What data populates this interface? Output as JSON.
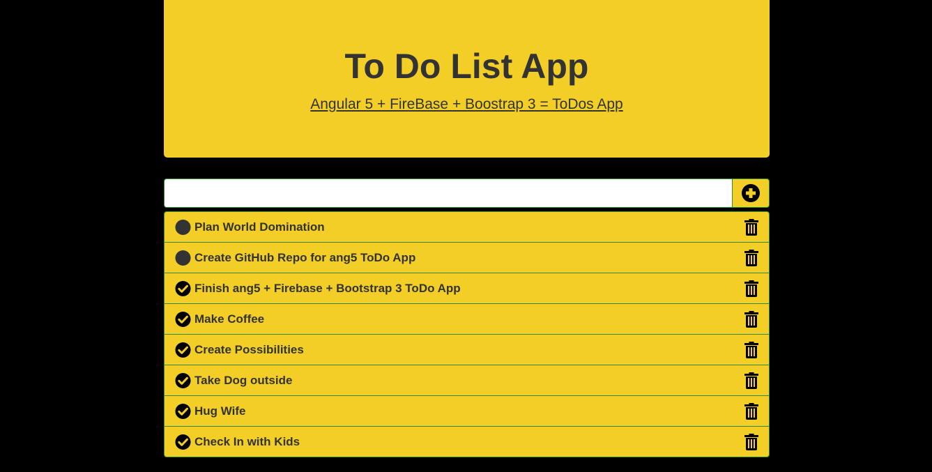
{
  "header": {
    "title": "To Do List App",
    "subtitle": "Angular 5 + FireBase + Boostrap 3 = ToDos App"
  },
  "add_form": {
    "input_value": "",
    "input_placeholder": "",
    "button_icon": "plus-circle-icon"
  },
  "todos": [
    {
      "text": "Plan World Domination",
      "done": false
    },
    {
      "text": "Create GitHub Repo for ang5 ToDo App",
      "done": false
    },
    {
      "text": "Finish ang5 + Firebase + Bootstrap 3 ToDo App",
      "done": true
    },
    {
      "text": "Make Coffee",
      "done": true
    },
    {
      "text": "Create Possibilities",
      "done": true
    },
    {
      "text": "Take Dog outside",
      "done": true
    },
    {
      "text": "Hug Wife",
      "done": true
    },
    {
      "text": "Check In with Kids",
      "done": true
    }
  ],
  "icons": {
    "pending": "circle-icon",
    "done": "check-circle-icon",
    "delete": "trash-icon"
  },
  "colors": {
    "background": "#000000",
    "accent": "#f2ce26",
    "text": "#333333",
    "border": "#2e8b2e"
  }
}
